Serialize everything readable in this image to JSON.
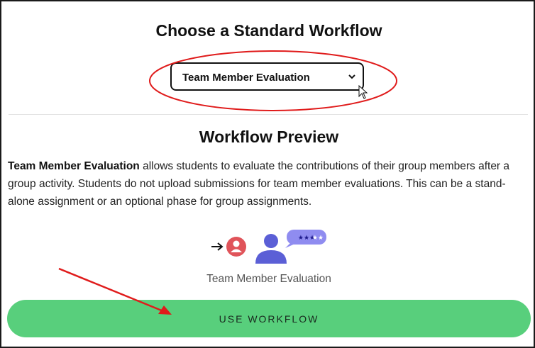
{
  "header": {
    "title": "Choose a Standard Workflow"
  },
  "workflow_select": {
    "value": "Team Member Evaluation"
  },
  "preview": {
    "title": "Workflow Preview",
    "description_bold": "Team Member Evaluation",
    "description_rest": " allows students to evaluate the contributions of their group members after a group activity. Students do not upload submissions for team member evaluations. This can be a stand-alone assignment or an optional phase for group assignments.",
    "illustration_caption": "Team Member Evaluation",
    "illustration_icons": [
      "arrow-right-icon",
      "user-circle-icon",
      "person-icon",
      "rating-bubble-icon"
    ]
  },
  "action": {
    "use_workflow_label": "USE WORKFLOW"
  },
  "colors": {
    "button_green": "#58cf7c",
    "annotation_red": "#e01b1b",
    "avatar_red": "#e0545a",
    "person_purple": "#5b5fd6",
    "bubble_purple": "#8f8cf0"
  }
}
